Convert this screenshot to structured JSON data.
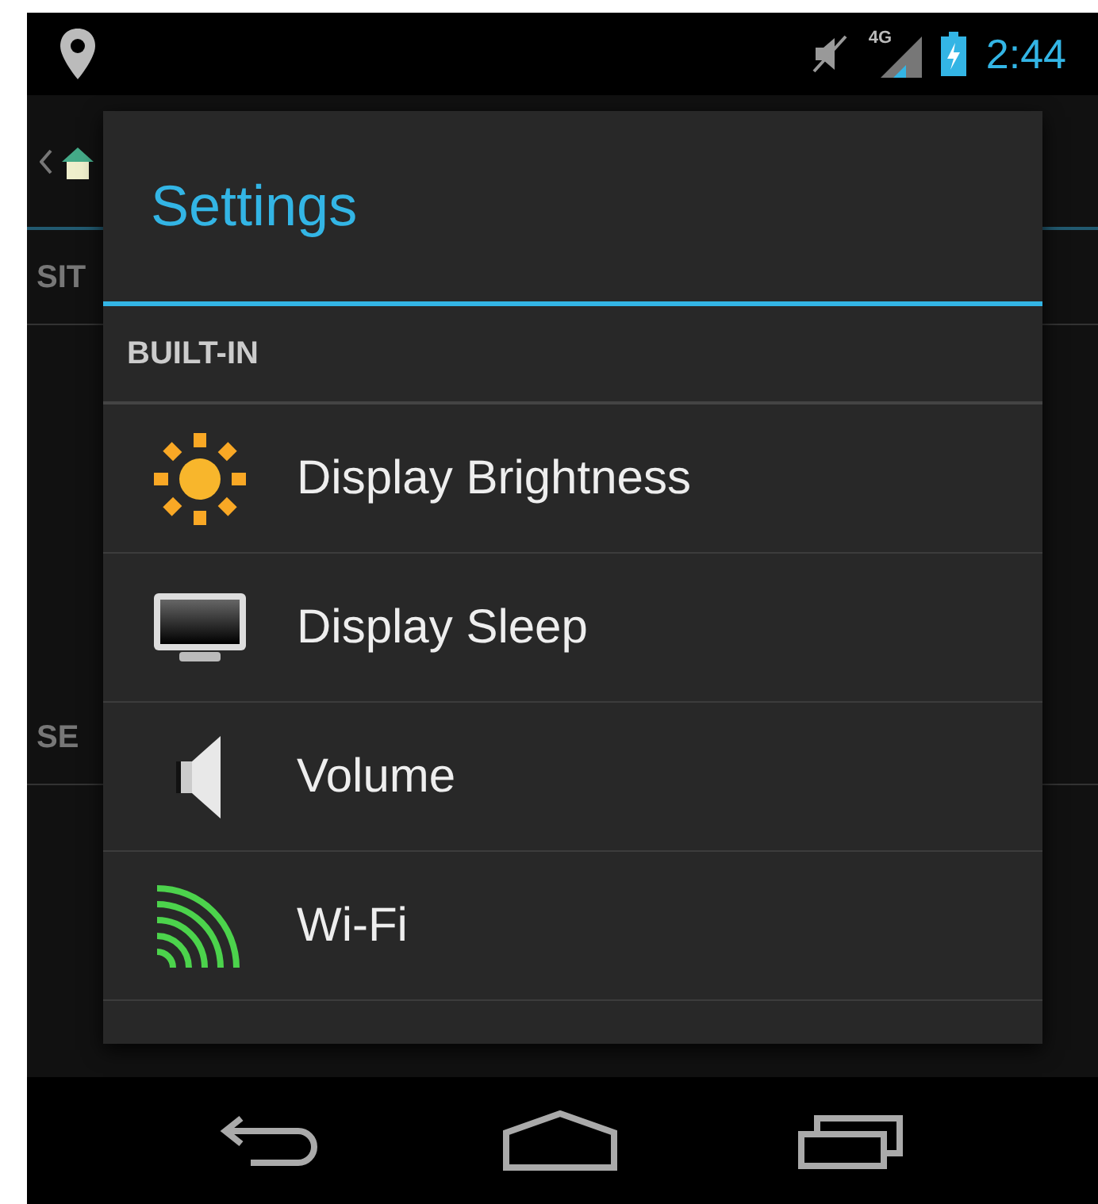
{
  "status_bar": {
    "network_type": "4G",
    "time": "2:44"
  },
  "background": {
    "section_headers": [
      "SIT",
      "SE"
    ]
  },
  "dialog": {
    "title": "Settings",
    "section": "BUILT-IN",
    "items": [
      {
        "label": "Display Brightness",
        "kind": "brightness"
      },
      {
        "label": "Display Sleep",
        "kind": "display"
      },
      {
        "label": "Volume",
        "kind": "volume"
      },
      {
        "label": "Wi-Fi",
        "kind": "wifi"
      }
    ]
  }
}
